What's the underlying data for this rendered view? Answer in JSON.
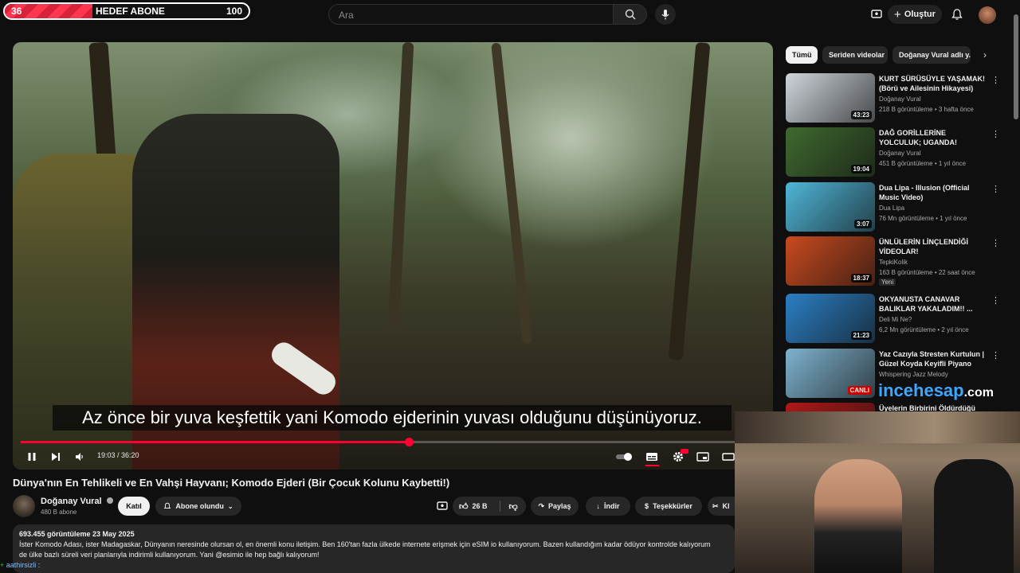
{
  "goal": {
    "current": "36",
    "title": "HEDEF ABONE",
    "target": "100",
    "progress": 0.36
  },
  "header": {
    "search_placeholder": "Ara",
    "create_label": "Oluştur"
  },
  "player": {
    "subtitle": "Az önce bir yuva keşfettik yani Komodo ejderinin yuvası olduğunu düşünüyoruz.",
    "time": "19:03 / 36:20",
    "progress": 0.524
  },
  "video": {
    "title": "Dünya'nın En Tehlikeli ve En Vahşi Hayvanı; Komodo Ejderi (Bir Çocuk Kolunu Kaybetti!)",
    "channel": "Doğanay Vural",
    "subscribers": "480 B abone",
    "join_label": "Katıl",
    "subscribed_label": "Abone olundu",
    "likes": "26 B",
    "share_label": "Paylaş",
    "download_label": "İndir",
    "thanks_label": "Teşekkürler",
    "clip_label": "Kl",
    "views_date": "693.455 görüntüleme  23 May 2025",
    "desc_line1": "İster Komodo Adası, ister Madagaskar, Dünyanın neresinde olursan ol, en önemli konu iletişim. Ben 160'tan fazla ülkede internete erişmek için eSIM io kullanıyorum.    Bazen kullandığım kadar ödüyor kontrolde kalıyorum",
    "desc_line2": "de ülke bazlı süreli veri planlarıyla indirimli kullanıyorum. Yani @esimio ile hep bağlı kalıyorum!"
  },
  "chips": [
    "Tümü",
    "Seriden videolar",
    "Doğanay Vural adlı y..."
  ],
  "recommendations": [
    {
      "title": "KURT SÜRÜSÜYLE YAŞAMAK! (Börü ve Ailesinin Hikayesi)",
      "channel": "Doğanay Vural",
      "meta": "218 B görüntüleme • 3 hafta önce",
      "duration": "43:23",
      "thumb_color": "#cfd6dc"
    },
    {
      "title": "DAĞ GORİLLERİNE YOLCULUK; UGANDA!",
      "channel": "Doğanay Vural",
      "meta": "451 B görüntüleme • 1 yıl önce",
      "duration": "19:04",
      "thumb_color": "#3f6a2f"
    },
    {
      "title": "Dua Lipa - Illusion (Official Music Video)",
      "channel": "Dua Lipa",
      "meta": "76 Mn görüntüleme • 1 yıl önce",
      "duration": "3:07",
      "thumb_color": "#4fb6d8"
    },
    {
      "title": "ÜNLÜLERİN LİNÇLENDİĞİ VİDEOLAR!",
      "channel": "TepkiKolik",
      "meta": "163 B görüntüleme • 22 saat önce",
      "badge": "Yeni",
      "duration": "18:37",
      "thumb_color": "#c94a1e"
    },
    {
      "title": "OKYANUSTA CANAVAR BALIKLAR YAKALADIM!! ...",
      "channel": "Deli Mi Ne?",
      "meta": "6,2 Mn görüntüleme • 2 yıl önce",
      "duration": "21:23",
      "thumb_color": "#2b7fc4"
    },
    {
      "title": "Yaz Cazıyla Stresten Kurtulun | Güzel Koyda Keyifli Piyano Ca...",
      "channel": "Whispering Jazz Melody",
      "meta": "",
      "duration": "CANLI",
      "thumb_color": "#7fb3cf"
    },
    {
      "title": "Üyelerin Birbirini Öldürdüğü",
      "channel": "",
      "meta": "",
      "duration": "",
      "thumb_color": "#b01818"
    }
  ],
  "overlay": {
    "brand_main": "incehesap",
    "brand_suffix": ".com"
  },
  "chat": {
    "user": "aathirsizli",
    "sep": ":"
  }
}
